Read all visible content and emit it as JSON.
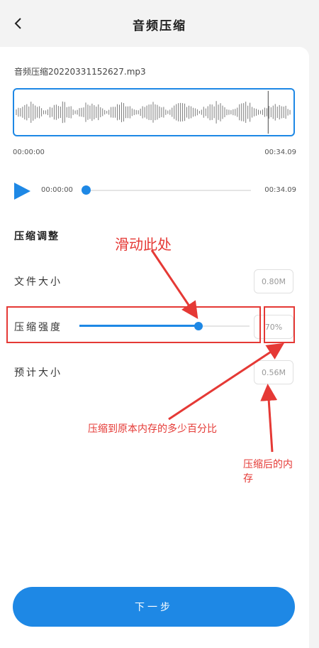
{
  "header": {
    "title": "音频压缩",
    "back_icon": "chevron-left-icon"
  },
  "file": {
    "name": "音频压缩20220331152627.mp3"
  },
  "waveform": {
    "start_time": "00:00:00",
    "end_time": "00:34.09"
  },
  "player": {
    "current": "00:00:00",
    "duration": "00:34.09",
    "progress": 0.0,
    "play_icon": "play-icon"
  },
  "section_title": "压缩调整",
  "rows": {
    "file_size": {
      "label": "文件大小",
      "value": "0.80M"
    },
    "strength": {
      "label": "压缩强度",
      "value": "70%",
      "level": 0.7
    },
    "estimate": {
      "label": "预计大小",
      "value": "0.56M"
    }
  },
  "next_button": "下一步",
  "annotations": {
    "slide_here": "滑动此处",
    "compress_percent": "压缩到原本内存的多少百分比",
    "after_size_line1": "压缩后的内",
    "after_size_line2": "存"
  },
  "colors": {
    "accent": "#1e88e5",
    "annotation": "#e53935"
  }
}
